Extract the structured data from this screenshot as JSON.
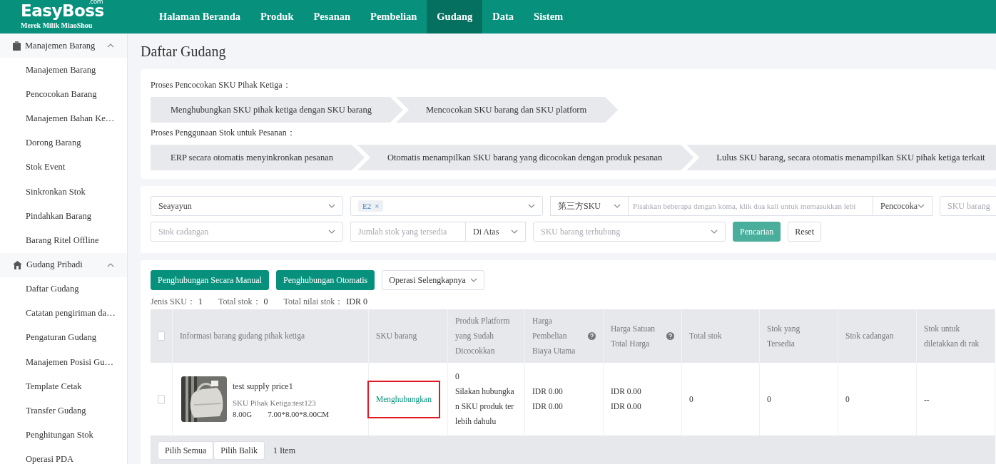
{
  "brand": {
    "name": "EasyBoss",
    "domain": ".com",
    "tagline": "Merek Milik MiaoShou"
  },
  "nav": [
    {
      "label": "Halaman Beranda",
      "selected": false
    },
    {
      "label": "Produk",
      "selected": false
    },
    {
      "label": "Pesanan",
      "selected": false
    },
    {
      "label": "Pembelian",
      "selected": false
    },
    {
      "label": "Gudang",
      "selected": true
    },
    {
      "label": "Data",
      "selected": false
    },
    {
      "label": "Sistem",
      "selected": false
    }
  ],
  "sidebar": [
    {
      "label": "Manajemen Barang",
      "expanded": true,
      "children": [
        {
          "label": "Manajemen Barang"
        },
        {
          "label": "Pencocokan Barang"
        },
        {
          "label": "Manajemen Bahan Ke…"
        },
        {
          "label": "Dorong Barang"
        },
        {
          "label": "Stok Event"
        },
        {
          "label": "Sinkronkan Stok"
        },
        {
          "label": "Pindahkan Barang"
        },
        {
          "label": "Barang Ritel Offline"
        }
      ]
    },
    {
      "label": "Gudang Pribadi",
      "expanded": true,
      "children": [
        {
          "label": "Daftar Gudang"
        },
        {
          "label": "Catatan pengiriman da…"
        },
        {
          "label": "Pengaturan Gudang"
        },
        {
          "label": "Manajemen Posisi Gu…"
        },
        {
          "label": "Template Cetak"
        },
        {
          "label": "Transfer Gudang"
        },
        {
          "label": "Penghitungan Stok"
        },
        {
          "label": "Operasi PDA"
        }
      ]
    }
  ],
  "page_title": "Daftar Gudang",
  "processes": [
    {
      "title": "Proses Pencocokan SKU Pihak Ketiga：",
      "steps": [
        "Menghubungkan SKU pihak ketiga dengan SKU barang",
        "Mencocokan SKU barang dan SKU platform"
      ]
    },
    {
      "title": "Proses Penggunaan Stok untuk Pesanan：",
      "steps": [
        "ERP secara otomatis menyinkronkan pesanan",
        "Otomatis menampilkan SKU barang yang dicocokan dengan produk pesanan",
        "Lulus SKU barang, secara otomatis menampilkan SKU pihak ketiga terkait"
      ]
    }
  ],
  "filters": [
    [
      {
        "kind": "select",
        "value": "Seayayun"
      },
      {
        "kind": "tags",
        "tags": [
          {
            "label": "E2",
            "remove": "×"
          }
        ]
      },
      {
        "kind": "select",
        "value": "第三方SKU"
      },
      {
        "kind": "input",
        "placeholder": "Pisahkan beberapa dengan koma, klik dua kali untuk memasukkan lebi"
      },
      {
        "kind": "select",
        "value": "Pencocoka"
      },
      {
        "kind": "input",
        "placeholder": "SKU barang"
      }
    ],
    [
      {
        "kind": "select",
        "placeholder": "Stok cadangan"
      },
      {
        "kind": "input",
        "placeholder": "Jumlah stok yang tersedia"
      },
      {
        "kind": "select",
        "value": "Di Atas"
      },
      {
        "kind": "select",
        "placeholder": "SKU barang terhubung"
      },
      {
        "kind": "primary",
        "label": "Pencarian"
      },
      {
        "kind": "plain",
        "label": "Reset"
      }
    ]
  ],
  "actions": [
    {
      "label": "Penghubungan Secara Manual",
      "kind": "primary"
    },
    {
      "label": "Penghubungan Otomatis",
      "kind": "primary"
    },
    {
      "label": "Operasi Selengkapnya",
      "kind": "dropdown"
    }
  ],
  "summary": [
    {
      "label": "Jenis SKU：",
      "value": "1"
    },
    {
      "label": "Total stok：",
      "value": "0"
    },
    {
      "label": "Total nilai stok：",
      "value": "IDR 0"
    }
  ],
  "table": {
    "all_checked": false,
    "columns": [
      {
        "lines": [
          "Informasi barang gudang pihak ketiga"
        ]
      },
      {
        "lines": [
          "SKU barang"
        ]
      },
      {
        "lines": [
          "Produk Platform",
          "yang Sudah",
          "Dicocokkan"
        ]
      },
      {
        "lines": [
          "Harga",
          "Pembelian",
          "Biaya Utama"
        ],
        "help": true
      },
      {
        "lines": [
          "Harga Satuan",
          "Total Harga"
        ],
        "help": true
      },
      {
        "lines": [
          "Total stok"
        ]
      },
      {
        "lines": [
          "Stok yang",
          "Tersedia"
        ]
      },
      {
        "lines": [
          "Stok cadangan"
        ]
      },
      {
        "lines": [
          "Stok untuk",
          "diletakkan di rak"
        ]
      }
    ],
    "rows": [
      {
        "checked": false,
        "name": "test supply price1",
        "third_party_sku": "SKU Pihak Ketiga:test123",
        "weight": "8.00G",
        "size": "7.00*8.00*8.00CM",
        "link": "Menghubungkan",
        "link_highlighted": true,
        "matched": [
          "0",
          "Silakan hubungka",
          "n SKU produk ter",
          "lebih dahulu"
        ],
        "purchase": [
          "IDR 0.00",
          "IDR 0.00"
        ],
        "unit": [
          "IDR 0.00",
          "IDR 0.00"
        ],
        "total": "0",
        "available": "0",
        "reserve": "0",
        "shelf": "--"
      }
    ]
  },
  "footer": {
    "buttons": [
      "Pilih Semua",
      "Pilih Balik"
    ],
    "count": "1 Item"
  }
}
